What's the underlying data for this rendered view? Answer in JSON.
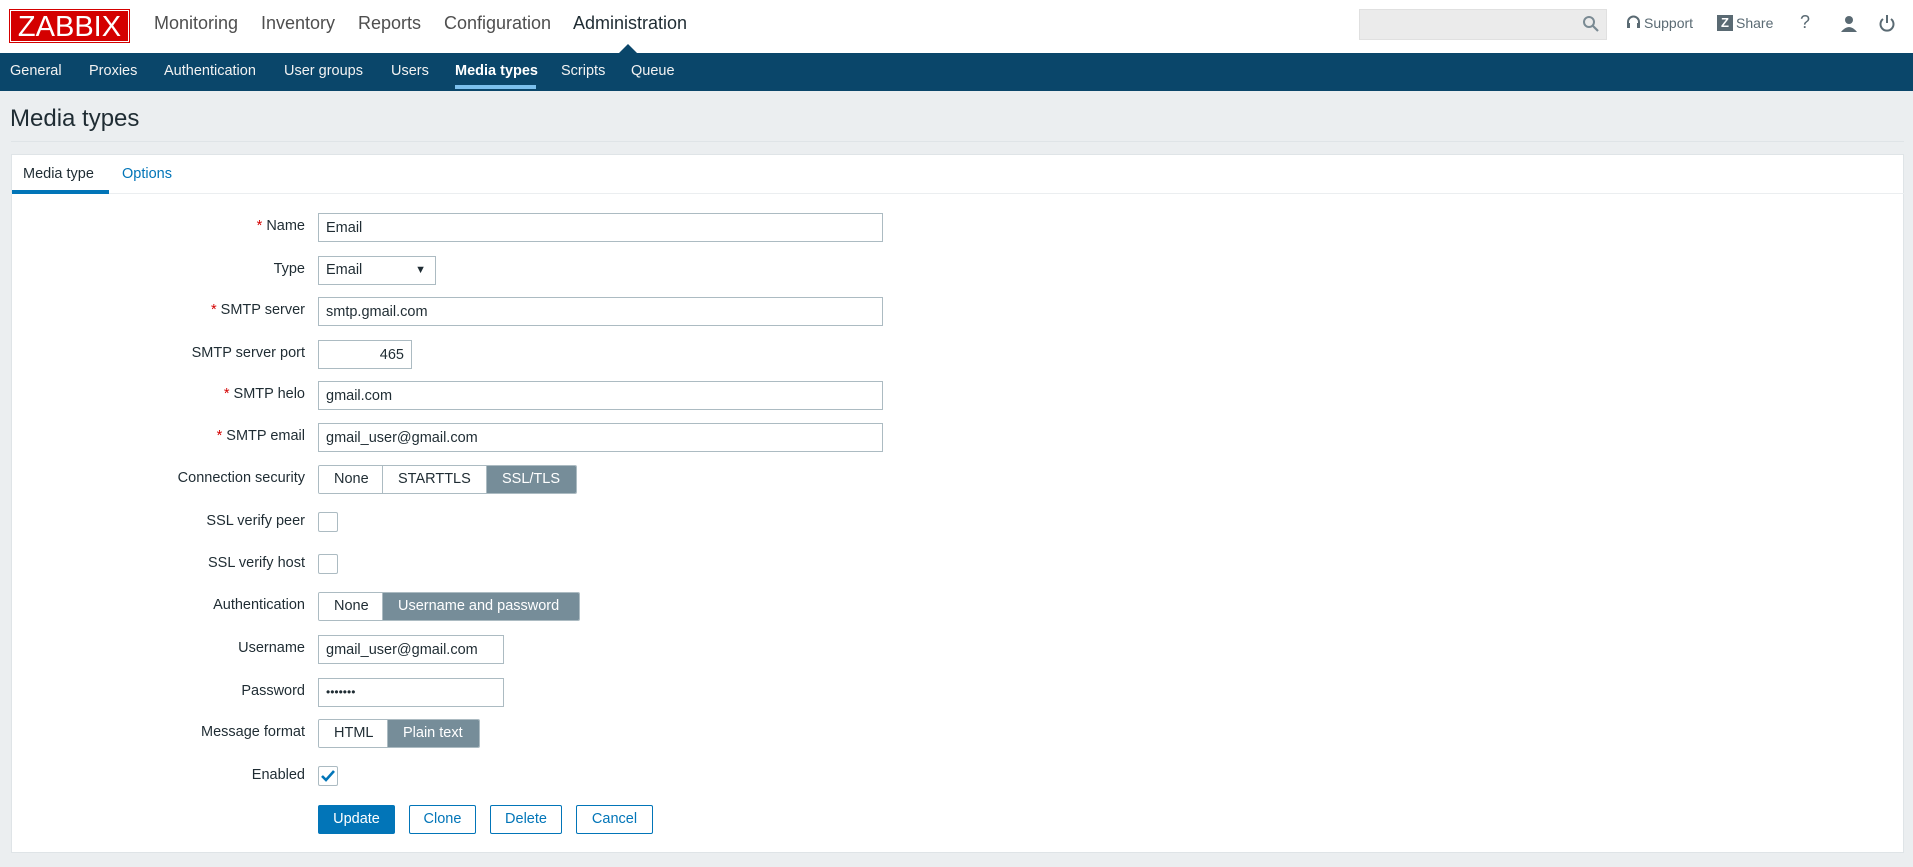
{
  "header": {
    "logo": "ZABBIX",
    "menu": [
      "Monitoring",
      "Inventory",
      "Reports",
      "Configuration",
      "Administration"
    ],
    "active_menu": "Administration",
    "search_placeholder": "",
    "support": "Support",
    "share": "Share",
    "help": "?",
    "icons": [
      "search-icon",
      "headset-icon",
      "share-z-icon",
      "help-icon",
      "user-icon",
      "power-icon"
    ]
  },
  "subnav": {
    "items": [
      "General",
      "Proxies",
      "Authentication",
      "User groups",
      "Users",
      "Media types",
      "Scripts",
      "Queue"
    ],
    "active": "Media types"
  },
  "page": {
    "title": "Media types"
  },
  "tabs": [
    "Media type",
    "Options"
  ],
  "active_tab": "Media type",
  "form": {
    "name": {
      "label": "Name",
      "value": "Email"
    },
    "type": {
      "label": "Type",
      "value": "Email"
    },
    "smtp_server": {
      "label": "SMTP server",
      "value": "smtp.gmail.com"
    },
    "smtp_port": {
      "label": "SMTP server port",
      "value": "465"
    },
    "smtp_helo": {
      "label": "SMTP helo",
      "value": "gmail.com"
    },
    "smtp_email": {
      "label": "SMTP email",
      "value": "gmail_user@gmail.com"
    },
    "connection_security": {
      "label": "Connection security",
      "options": [
        "None",
        "STARTTLS",
        "SSL/TLS"
      ],
      "selected": "SSL/TLS"
    },
    "ssl_verify_peer": {
      "label": "SSL verify peer",
      "checked": false
    },
    "ssl_verify_host": {
      "label": "SSL verify host",
      "checked": false
    },
    "authentication": {
      "label": "Authentication",
      "options": [
        "None",
        "Username and password"
      ],
      "selected": "Username and password"
    },
    "username": {
      "label": "Username",
      "value": "gmail_user@gmail.com"
    },
    "password": {
      "label": "Password",
      "value": "•••••••"
    },
    "message_format": {
      "label": "Message format",
      "options": [
        "HTML",
        "Plain text"
      ],
      "selected": "Plain text"
    },
    "enabled": {
      "label": "Enabled",
      "checked": true
    },
    "required_mark": "*"
  },
  "buttons": {
    "update": "Update",
    "clone": "Clone",
    "delete": "Delete",
    "cancel": "Cancel"
  },
  "colors": {
    "nav": "#0a466a",
    "accent": "#0275b8",
    "selected_segment": "#768d99",
    "logo": "#d40000",
    "active_underline": "#7cc0ed"
  }
}
